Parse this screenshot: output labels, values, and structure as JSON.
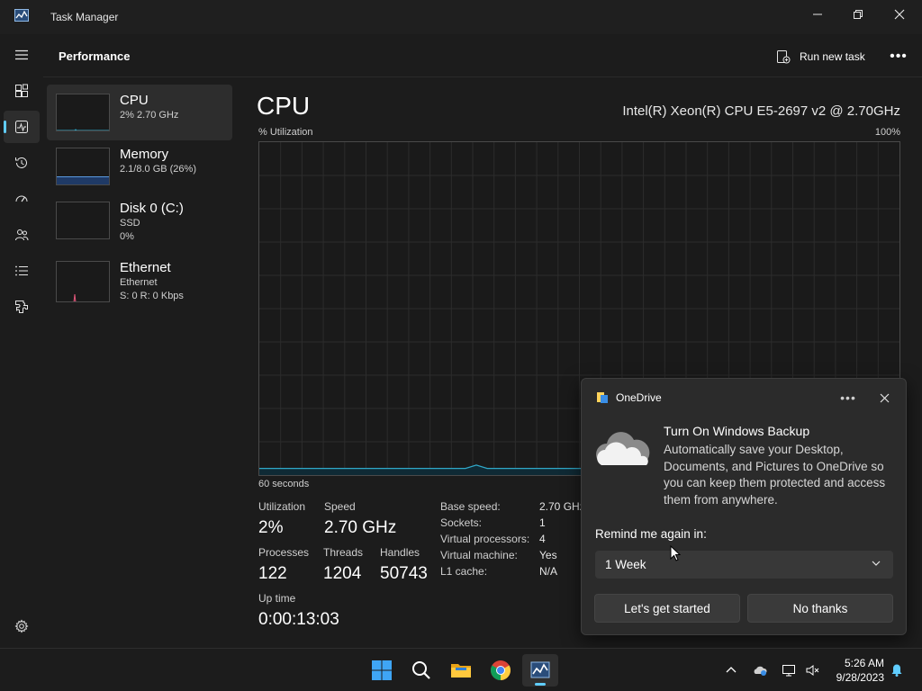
{
  "window": {
    "title": "Task Manager",
    "controls": {
      "minimize": "—",
      "maximize": "❐",
      "close": "✕"
    }
  },
  "rail": {
    "items": [
      {
        "name": "hamburger-menu-icon"
      },
      {
        "name": "processes-icon"
      },
      {
        "name": "performance-icon",
        "active": true
      },
      {
        "name": "app-history-icon"
      },
      {
        "name": "startup-apps-icon"
      },
      {
        "name": "users-icon"
      },
      {
        "name": "details-icon"
      },
      {
        "name": "services-icon"
      },
      {
        "name": "settings-icon"
      }
    ]
  },
  "header": {
    "title": "Performance",
    "run_task_label": "Run new task",
    "more": "•••"
  },
  "resources": [
    {
      "name": "CPU",
      "sub1": "2% 2.70 GHz",
      "sub2": "",
      "selected": true
    },
    {
      "name": "Memory",
      "sub1": "2.1/8.0 GB (26%)",
      "sub2": ""
    },
    {
      "name": "Disk 0 (C:)",
      "sub1": "SSD",
      "sub2": "0%"
    },
    {
      "name": "Ethernet",
      "sub1": "Ethernet",
      "sub2": "S: 0 R: 0 Kbps"
    }
  ],
  "cpu": {
    "title": "CPU",
    "model": "Intel(R) Xeon(R) CPU E5-2697 v2 @ 2.70GHz",
    "y_label": "% Utilization",
    "y_max": "100%",
    "x_label": "60 seconds",
    "stats": {
      "utilization_label": "Utilization",
      "utilization": "2%",
      "speed_label": "Speed",
      "speed": "2.70 GHz",
      "processes_label": "Processes",
      "processes": "122",
      "threads_label": "Threads",
      "threads": "1204",
      "handles_label": "Handles",
      "handles": "50743",
      "uptime_label": "Up time",
      "uptime": "0:00:13:03"
    },
    "details": [
      {
        "k": "Base speed:",
        "v": "2.70 GHz"
      },
      {
        "k": "Sockets:",
        "v": "1"
      },
      {
        "k": "Virtual processors:",
        "v": "4"
      },
      {
        "k": "Virtual machine:",
        "v": "Yes"
      },
      {
        "k": "L1 cache:",
        "v": "N/A"
      }
    ]
  },
  "chart_data": {
    "type": "line",
    "ylim": [
      0,
      100
    ],
    "series": [
      {
        "values": [
          2,
          2,
          2,
          2,
          2,
          2,
          2,
          2,
          2,
          2,
          2,
          2,
          2,
          2,
          2,
          2,
          2,
          2,
          2,
          2,
          3,
          2,
          2,
          2,
          2,
          2,
          2,
          2,
          2,
          2,
          2,
          2,
          2,
          2,
          2,
          2,
          2,
          2,
          2,
          2,
          2,
          6,
          2,
          2,
          2,
          2,
          2,
          2,
          2,
          2,
          2,
          2,
          2,
          2,
          2,
          2,
          2,
          2,
          2,
          2
        ]
      }
    ]
  },
  "toast": {
    "app": "OneDrive",
    "more": "•••",
    "close": "✕",
    "heading": "Turn On Windows Backup",
    "body": "Automatically save your Desktop, Documents, and Pictures to OneDrive so you can keep them protected and access them from anywhere.",
    "remind_label": "Remind me again in:",
    "remind_value": "1 Week",
    "primary_button": "Let's get started",
    "secondary_button": "No thanks"
  },
  "taskbar": {
    "time": "5:26 AM",
    "date": "9/28/2023",
    "colors": {
      "accent": "#60cdff",
      "graph_line": "#30a8c8",
      "network_spike": "#e0577a"
    }
  }
}
